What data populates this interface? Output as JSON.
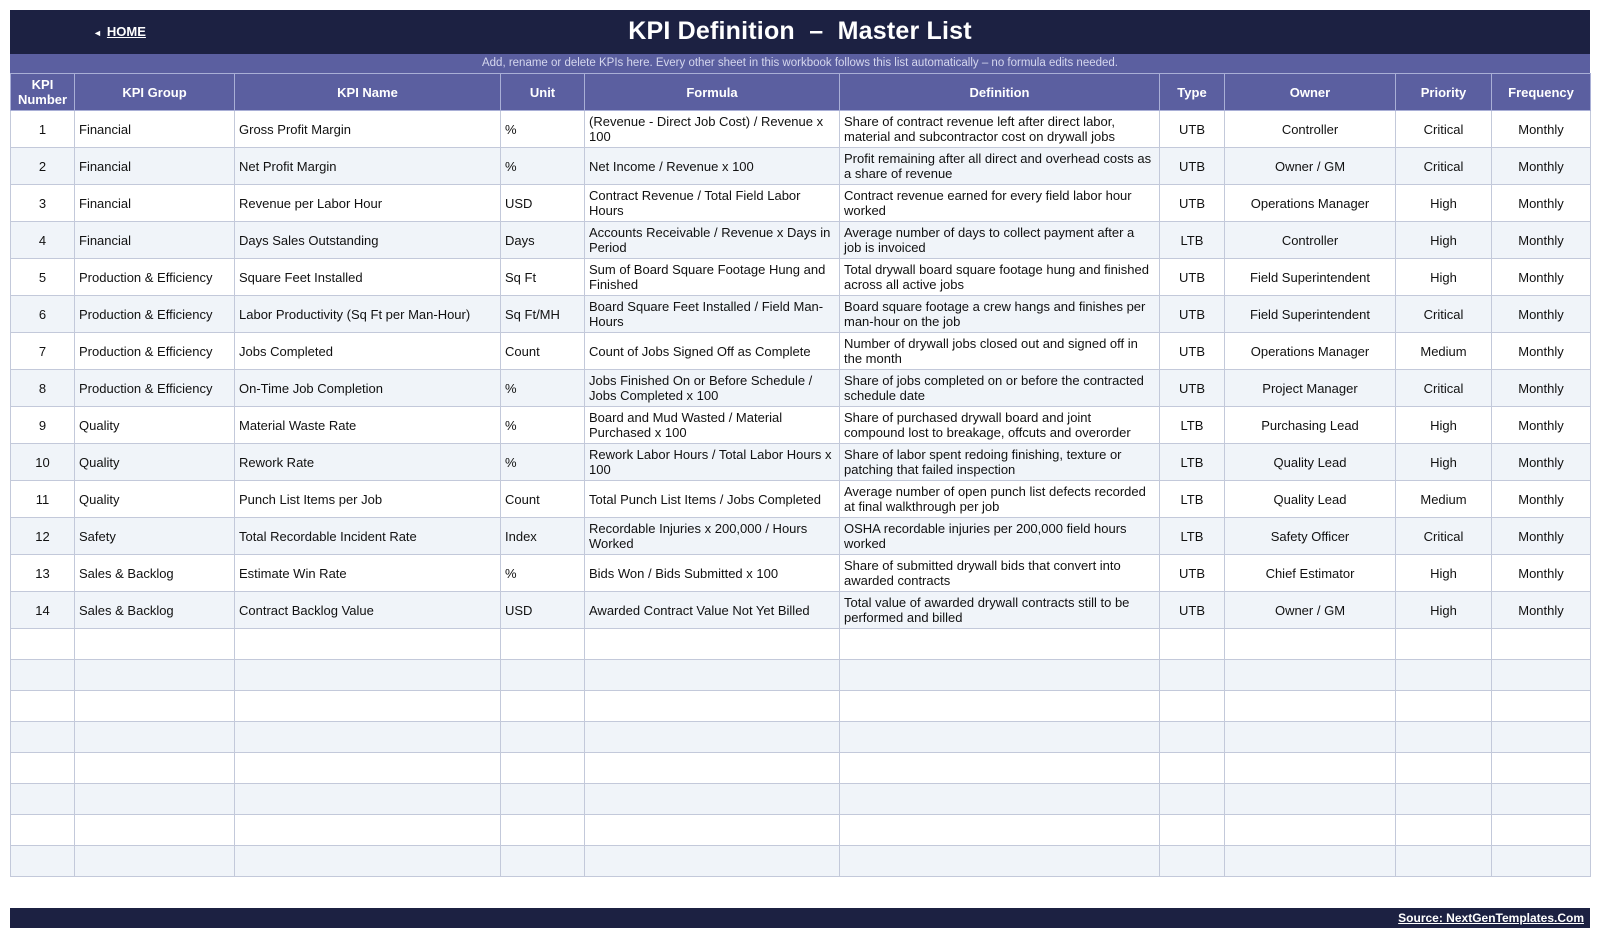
{
  "header": {
    "home_label": "HOME",
    "title": "KPI Definition  –  Master List",
    "subtitle": "Add, rename or delete KPIs here. Every other sheet in this workbook follows this list automatically – no formula edits needed."
  },
  "table": {
    "columns": [
      "KPI Number",
      "KPI Group",
      "KPI Name",
      "Unit",
      "Formula",
      "Definition",
      "Type",
      "Owner",
      "Priority",
      "Frequency"
    ],
    "rows": [
      [
        "1",
        "Financial",
        "Gross Profit Margin",
        "%",
        "(Revenue - Direct Job Cost) / Revenue x 100",
        "Share of contract revenue left after direct labor, material and subcontractor cost on drywall jobs",
        "UTB",
        "Controller",
        "Critical",
        "Monthly"
      ],
      [
        "2",
        "Financial",
        "Net Profit Margin",
        "%",
        "Net Income / Revenue x 100",
        "Profit remaining after all direct and overhead costs as a share of revenue",
        "UTB",
        "Owner / GM",
        "Critical",
        "Monthly"
      ],
      [
        "3",
        "Financial",
        "Revenue per Labor Hour",
        "USD",
        "Contract Revenue / Total Field Labor Hours",
        "Contract revenue earned for every field labor hour worked",
        "UTB",
        "Operations Manager",
        "High",
        "Monthly"
      ],
      [
        "4",
        "Financial",
        "Days Sales Outstanding",
        "Days",
        "Accounts Receivable / Revenue x Days in Period",
        "Average number of days to collect payment after a job is invoiced",
        "LTB",
        "Controller",
        "High",
        "Monthly"
      ],
      [
        "5",
        "Production & Efficiency",
        "Square Feet Installed",
        "Sq Ft",
        "Sum of Board Square Footage Hung and Finished",
        "Total drywall board square footage hung and finished across all active jobs",
        "UTB",
        "Field Superintendent",
        "High",
        "Monthly"
      ],
      [
        "6",
        "Production & Efficiency",
        "Labor Productivity (Sq Ft per Man-Hour)",
        "Sq Ft/MH",
        "Board Square Feet Installed / Field Man-Hours",
        "Board square footage a crew hangs and finishes per man-hour on the job",
        "UTB",
        "Field Superintendent",
        "Critical",
        "Monthly"
      ],
      [
        "7",
        "Production & Efficiency",
        "Jobs Completed",
        "Count",
        "Count of Jobs Signed Off as Complete",
        "Number of drywall jobs closed out and signed off in the month",
        "UTB",
        "Operations Manager",
        "Medium",
        "Monthly"
      ],
      [
        "8",
        "Production & Efficiency",
        "On-Time Job Completion",
        "%",
        "Jobs Finished On or Before Schedule / Jobs Completed x 100",
        "Share of jobs completed on or before the contracted schedule date",
        "UTB",
        "Project Manager",
        "Critical",
        "Monthly"
      ],
      [
        "9",
        "Quality",
        "Material Waste Rate",
        "%",
        "Board and Mud Wasted / Material Purchased x 100",
        "Share of purchased drywall board and joint compound lost to breakage, offcuts and overorder",
        "LTB",
        "Purchasing Lead",
        "High",
        "Monthly"
      ],
      [
        "10",
        "Quality",
        "Rework Rate",
        "%",
        "Rework Labor Hours / Total Labor Hours x 100",
        "Share of labor spent redoing finishing, texture or patching that failed inspection",
        "LTB",
        "Quality Lead",
        "High",
        "Monthly"
      ],
      [
        "11",
        "Quality",
        "Punch List Items per Job",
        "Count",
        "Total Punch List Items / Jobs Completed",
        "Average number of open punch list defects recorded at final walkthrough per job",
        "LTB",
        "Quality Lead",
        "Medium",
        "Monthly"
      ],
      [
        "12",
        "Safety",
        "Total Recordable Incident Rate",
        "Index",
        "Recordable Injuries x 200,000 / Hours Worked",
        "OSHA recordable injuries per 200,000 field hours worked",
        "LTB",
        "Safety Officer",
        "Critical",
        "Monthly"
      ],
      [
        "13",
        "Sales & Backlog",
        "Estimate Win Rate",
        "%",
        "Bids Won / Bids Submitted x 100",
        "Share of submitted drywall bids that convert into awarded contracts",
        "UTB",
        "Chief Estimator",
        "High",
        "Monthly"
      ],
      [
        "14",
        "Sales & Backlog",
        "Contract Backlog Value",
        "USD",
        "Awarded Contract Value Not Yet Billed",
        "Total value of awarded drywall contracts still to be performed and billed",
        "UTB",
        "Owner / GM",
        "High",
        "Monthly"
      ]
    ],
    "blank_row_count": 8
  },
  "footer": {
    "source_label": "Source: NextGenTemplates.Com"
  },
  "colors": {
    "header_bg": "#1c2142",
    "band_bg": "#5b5fa0",
    "alt_row_bg": "#f0f4f9",
    "grid_line": "#c3c9da"
  },
  "icons": {
    "home": "triangle-left-icon"
  }
}
